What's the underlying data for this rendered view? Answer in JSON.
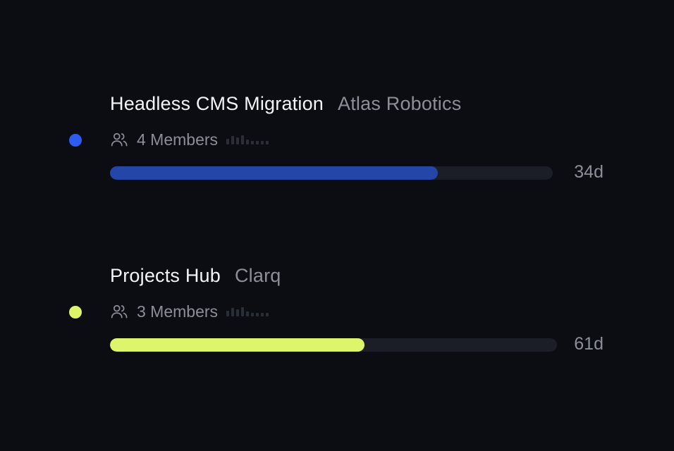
{
  "projects": [
    {
      "name": "Headless CMS Migration",
      "client": "Atlas Robotics",
      "members_label": "4 Members",
      "members_icon": "users-icon",
      "progress": 0.74,
      "days_label": "34d",
      "accent_color": "#2e5bf0",
      "fill_color": "#2446a8"
    },
    {
      "name": "Projects Hub",
      "client": "Clarq",
      "members_label": "3 Members",
      "members_icon": "users-icon",
      "progress": 0.57,
      "days_label": "61d",
      "accent_color": "#dcf56b",
      "fill_color": "#dcf56b"
    }
  ]
}
